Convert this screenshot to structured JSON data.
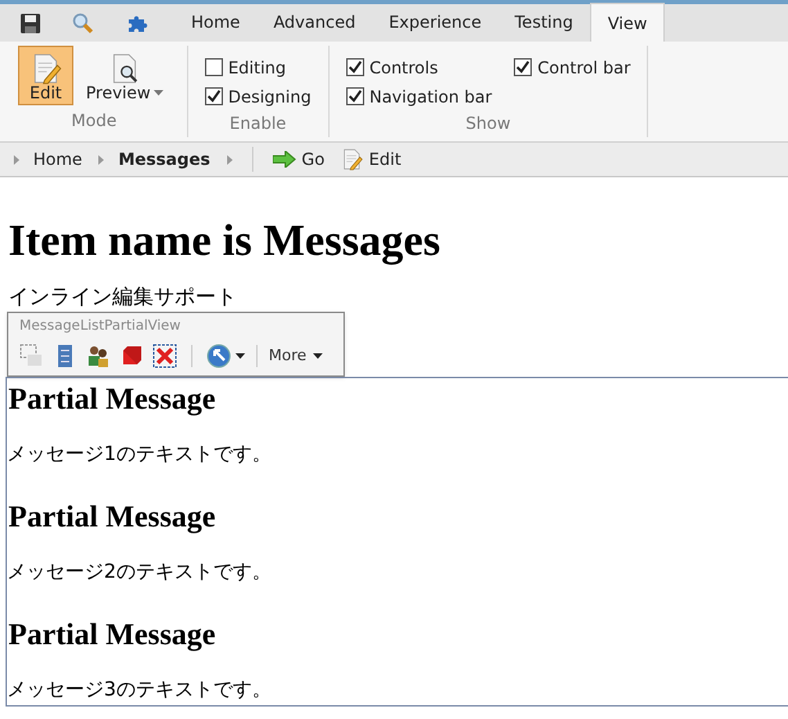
{
  "tabs": [
    {
      "label": "Home",
      "selected": false
    },
    {
      "label": "Advanced",
      "selected": false
    },
    {
      "label": "Experience",
      "selected": false
    },
    {
      "label": "Testing",
      "selected": false
    },
    {
      "label": "View",
      "selected": true
    }
  ],
  "ribbon": {
    "groups": [
      {
        "kind": "mode",
        "label": "Mode",
        "buttons": [
          {
            "label": "Edit",
            "selected": true,
            "kind": "edit"
          },
          {
            "label": "Preview",
            "selected": false,
            "kind": "preview",
            "dropdown": true
          }
        ]
      },
      {
        "kind": "checks",
        "label": "Enable",
        "checkboxes": [
          {
            "label": "Editing",
            "checked": false
          },
          {
            "label": "Designing",
            "checked": true
          }
        ]
      },
      {
        "kind": "checks",
        "label": "Show",
        "checkboxes": [
          {
            "label": "Controls",
            "checked": true
          },
          {
            "label": "Navigation bar",
            "checked": true
          },
          {
            "label": "Control bar",
            "checked": true
          }
        ]
      }
    ]
  },
  "breadcrumb": {
    "items": [
      {
        "label": "Home",
        "current": false
      },
      {
        "label": "Messages",
        "current": true
      }
    ],
    "actions": [
      {
        "label": "Go",
        "kind": "go"
      },
      {
        "label": "Edit",
        "kind": "edit"
      }
    ]
  },
  "page": {
    "title": "Item name is Messages",
    "subtitle": "インライン編集サポート",
    "floating_toolbar": {
      "title": "MessageListPartialView",
      "more": "More"
    },
    "messages": [
      {
        "heading": "Partial Message",
        "text": "メッセージ1のテキストです。"
      },
      {
        "heading": "Partial Message",
        "text": "メッセージ2のテキストです。"
      },
      {
        "heading": "Partial Message",
        "text": "メッセージ3のテキストです。"
      }
    ]
  }
}
